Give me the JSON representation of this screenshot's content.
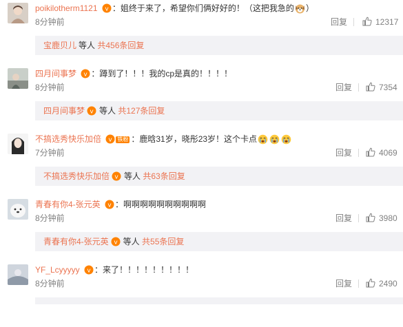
{
  "comments": [
    {
      "username": "poikilotherm1121",
      "text": "：姐终于来了，希望你们俩好好的！（这把我急的",
      "text_after": "）",
      "emoji_after_text": "dog-face-emoji",
      "time": "8分钟前",
      "reply_label": "回复",
      "likes": "12317",
      "sub_user": "宝鹿贝儿",
      "sub_etc": "等人",
      "sub_count": "共456条回复",
      "sub_badge": false
    },
    {
      "username": "四月间事梦",
      "text": "：蹲到了！！！我的cp是真的！！！！",
      "time": "8分钟前",
      "reply_label": "回复",
      "likes": "7354",
      "sub_user": "四月间事梦",
      "sub_etc": "等人",
      "sub_count": "共127条回复",
      "sub_badge": true
    },
    {
      "username": "不搞选秀快乐加倍",
      "tag": "铁粉",
      "text": "：鹿晗31岁，晓彤23岁！这个卡点",
      "emoji_after_text": "crying-emoji",
      "time": "7分钟前",
      "reply_label": "回复",
      "likes": "4069",
      "sub_user": "不搞选秀快乐加倍",
      "sub_etc": "等人",
      "sub_count": "共63条回复",
      "sub_badge": true
    },
    {
      "username": "青春有你4-张元英",
      "text": "：啊啊啊啊啊啊啊啊啊啊",
      "time": "8分钟前",
      "reply_label": "回复",
      "likes": "3980",
      "sub_user": "青春有你4-张元英",
      "sub_etc": "等人",
      "sub_count": "共55条回复",
      "sub_badge": true
    },
    {
      "username": "YF_Lcyyyyy",
      "text": "：来了！！！！！！！！！",
      "time": "8分钟前",
      "reply_label": "回复",
      "likes": "2490"
    }
  ],
  "colors": {
    "username": "#eb7350",
    "meta": "#808080",
    "reply_box": "#f2f2f5",
    "badge": "#ff8200"
  }
}
